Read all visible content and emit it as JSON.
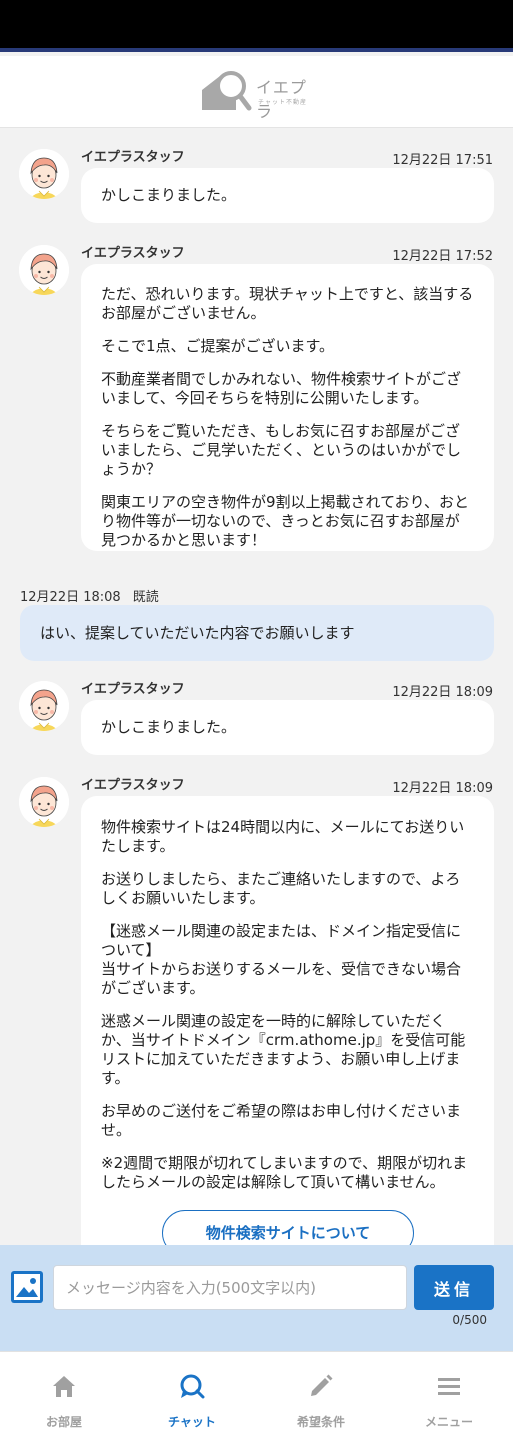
{
  "header": {
    "brand": "イエプラ",
    "tagline": "チャット不動産"
  },
  "messages": [
    {
      "sender": "イエプラスタッフ",
      "time": "12月22日 17:51",
      "paragraphs": [
        "かしこまりました。"
      ]
    },
    {
      "sender": "イエプラスタッフ",
      "time": "12月22日 17:52",
      "paragraphs": [
        "ただ、恐れいります。現状チャット上ですと、該当するお部屋がございません。",
        "そこで1点、ご提案がございます。",
        "不動産業者間でしかみれない、物件検索サイトがございまして、今回そちらを特別に公開いたします。",
        "そちらをご覧いただき、もしお気に召すお部屋がございましたら、ご見学いただく、というのはいかがでしょうか？",
        "関東エリアの空き物件が9割以上掲載されており、おとり物件等が一切ないので、きっとお気に召すお部屋が見つかるかと思います！"
      ]
    },
    {
      "user": true,
      "time": "12月22日 18:08",
      "status": "既読",
      "text": "はい、提案していただいた内容でお願いします"
    },
    {
      "sender": "イエプラスタッフ",
      "time": "12月22日 18:09",
      "paragraphs": [
        "かしこまりました。"
      ]
    },
    {
      "sender": "イエプラスタッフ",
      "time": "12月22日 18:09",
      "paragraphs": [
        "物件検索サイトは24時間以内に、メールにてお送りいたします。",
        "お送りしましたら、またご連絡いたしますので、よろしくお願いいたします。",
        "【迷惑メール関連の設定または、ドメイン指定受信について】\n当サイトからお送りするメールを、受信できない場合がございます。",
        "迷惑メール関連の設定を一時的に解除していただくか、当サイトドメイン『crm.athome.jp』を受信可能リストに加えていただきますよう、お願い申し上げます。",
        "お早めのご送付をご希望の際はお申し付けくださいませ。",
        "※2週間で期限が切れてしまいますので、期限が切れましたらメールの設定は解除して頂いて構いません。"
      ],
      "button_label": "物件検索サイトについて"
    }
  ],
  "composer": {
    "placeholder": "メッセージ内容を入力(500文字以内)",
    "value": "",
    "send_label": "送信",
    "counter": "0/500"
  },
  "nav": {
    "items": [
      {
        "label": "お部屋",
        "icon": "home-icon",
        "active": false
      },
      {
        "label": "チャット",
        "icon": "chat-icon",
        "active": true
      },
      {
        "label": "希望条件",
        "icon": "pencil-icon",
        "active": false
      },
      {
        "label": "メニュー",
        "icon": "menu-icon",
        "active": false
      }
    ]
  },
  "colors": {
    "accent": "#1a73c6",
    "user_bubble": "#dfeaf8",
    "composer_bg": "#c9def3",
    "chat_bg": "#f2f2f2"
  }
}
